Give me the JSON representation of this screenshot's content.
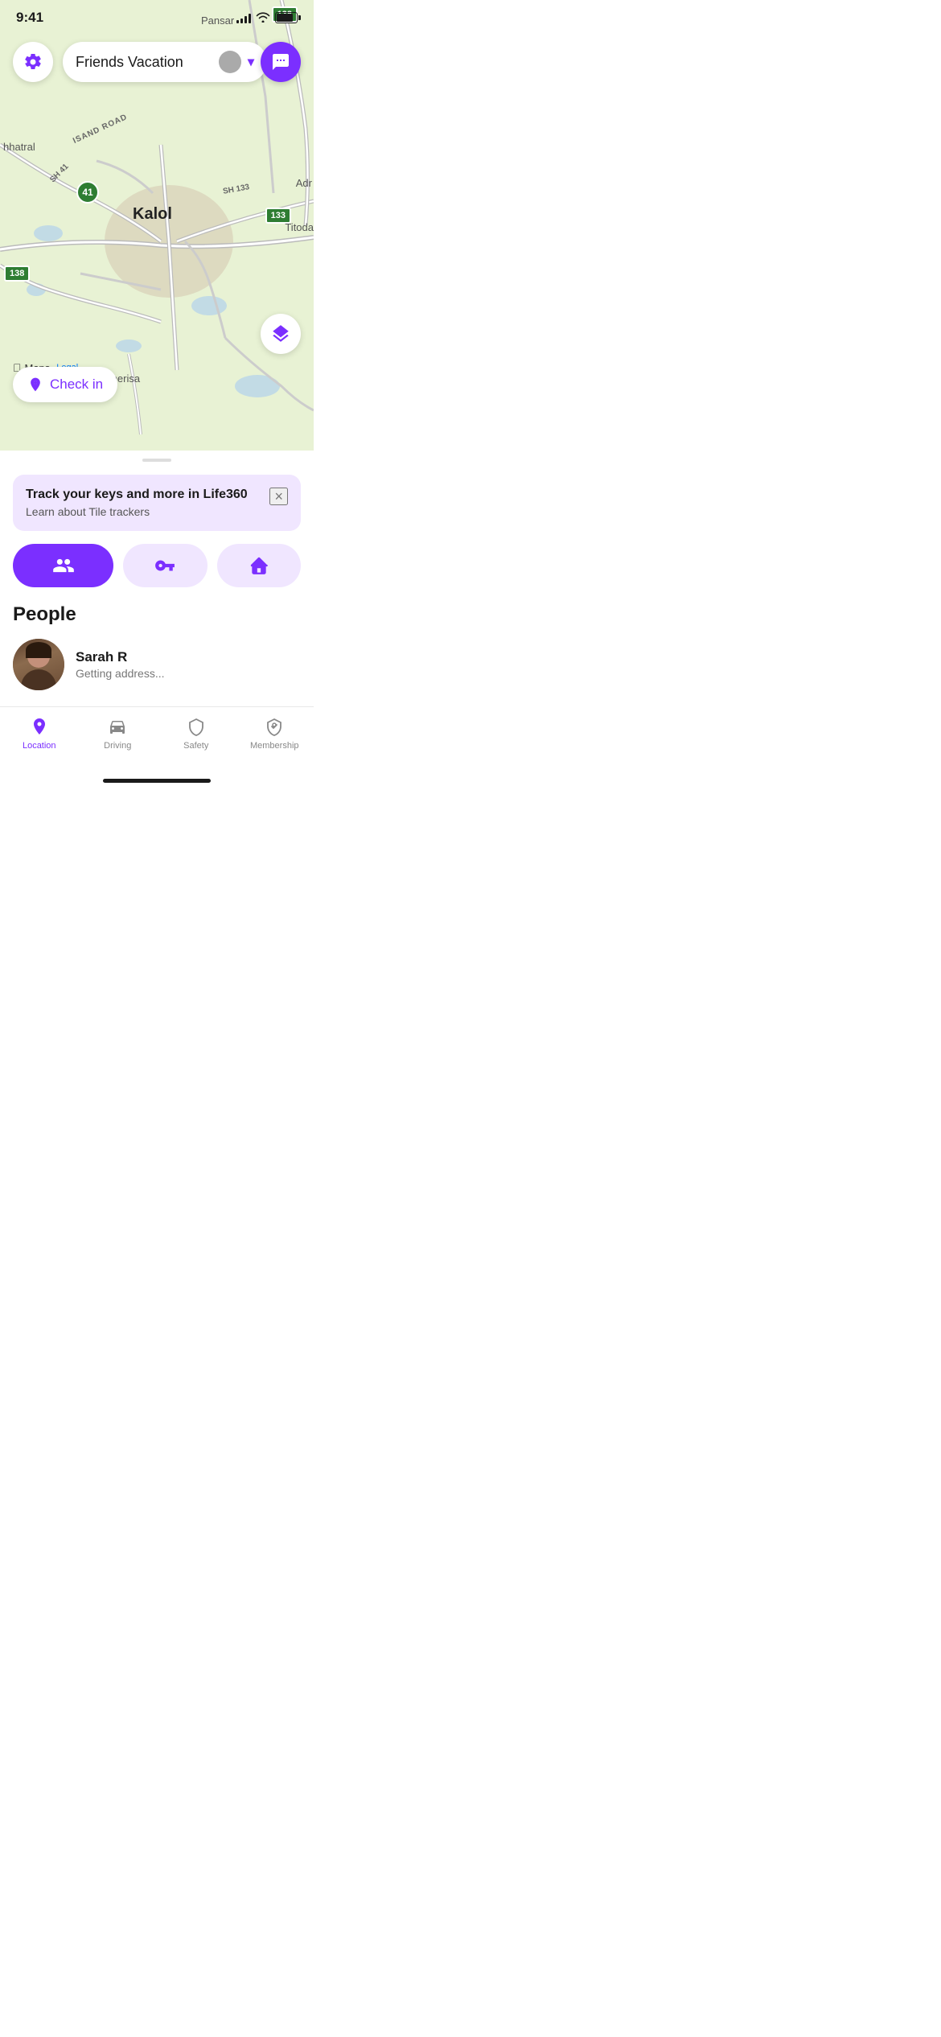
{
  "statusBar": {
    "time": "9:41",
    "batteryLevel": 85
  },
  "map": {
    "labels": {
      "kalol": "Kalol",
      "pansar": "Pansar",
      "hhatral": "hhatral",
      "adr": "Adr",
      "titoda": "Titoda",
      "sherisa": "Sherisa",
      "isandRoad": "ISAND ROAD",
      "sh41": "SH 41",
      "sh133": "SH 133"
    },
    "signs": {
      "sh138top": "138",
      "sh41": "41",
      "sh133": "133",
      "sh138left": "138"
    },
    "watermark": {
      "apple": "",
      "maps": "Maps",
      "legal": "Legal"
    }
  },
  "groupSelector": {
    "name": "Friends Vacation",
    "dropdownLabel": "▾"
  },
  "buttons": {
    "settings": "⚙",
    "checkin": "Check in",
    "layers": "layers"
  },
  "tileBanner": {
    "title": "Track your keys and more in Life360",
    "subtitle": "Learn about Tile trackers",
    "closeLabel": "×"
  },
  "actionButtons": {
    "people": "people",
    "tile": "tile",
    "places": "places"
  },
  "people": {
    "sectionTitle": "People",
    "members": [
      {
        "name": "Sarah R",
        "status": "Getting address..."
      }
    ]
  },
  "bottomNav": {
    "items": [
      {
        "id": "location",
        "label": "Location",
        "active": true
      },
      {
        "id": "driving",
        "label": "Driving",
        "active": false
      },
      {
        "id": "safety",
        "label": "Safety",
        "active": false
      },
      {
        "id": "membership",
        "label": "Membership",
        "active": false
      }
    ]
  },
  "colors": {
    "purple": "#7b2fff",
    "purpleLight": "#f0e6ff",
    "mapGreen": "#e8f2d4",
    "active": "#7b2fff",
    "inactive": "#888888"
  }
}
